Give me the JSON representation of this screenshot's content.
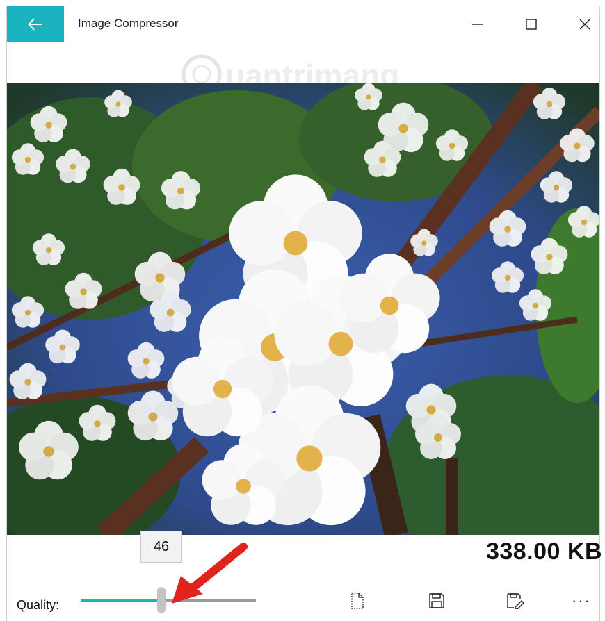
{
  "window": {
    "title": "Image Compressor",
    "accent_color": "#1ab3c0"
  },
  "titlebar": {
    "back_icon": "arrow-left-icon",
    "minimize_icon": "minimize-icon",
    "maximize_icon": "maximize-icon",
    "close_icon": "close-icon"
  },
  "image": {
    "watermark": "Quantrimang"
  },
  "compressed_size": "338.00 KB",
  "quality": {
    "label": "Quality:",
    "value": "46",
    "min": 0,
    "max": 100,
    "level": 0.46
  },
  "toolbar": {
    "items": [
      {
        "icon": "new-file-icon"
      },
      {
        "icon": "save-icon"
      },
      {
        "icon": "save-as-icon"
      },
      {
        "icon": "more-options-icon",
        "label": "···"
      }
    ]
  }
}
